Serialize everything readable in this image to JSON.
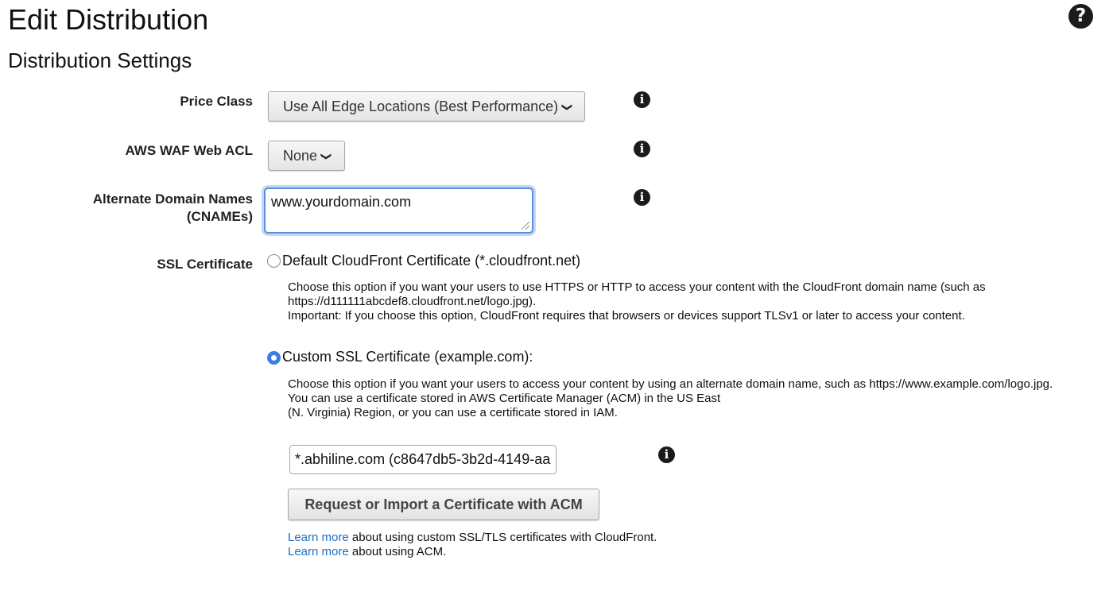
{
  "header": {
    "title": "Edit Distribution",
    "help_icon": "question-circle-icon",
    "help_glyph": "?"
  },
  "section": {
    "title": "Distribution Settings"
  },
  "fields": {
    "price_class": {
      "label": "Price Class",
      "value": "Use All Edge Locations (Best Performance)"
    },
    "waf": {
      "label": "AWS WAF Web ACL",
      "value": "None"
    },
    "cnames": {
      "label_line1": "Alternate Domain Names",
      "label_line2": "(CNAMEs)",
      "value": "www.yourdomain.com"
    },
    "ssl": {
      "label": "SSL Certificate"
    }
  },
  "info_icon": {
    "icon": "info-circle-icon",
    "glyph": "i"
  },
  "chevron_glyph": "❯",
  "ssl_options": {
    "default": {
      "label": "Default CloudFront Certificate (*.cloudfront.net)",
      "selected": false,
      "desc_line1": "Choose this option if you want your users to use HTTPS or HTTP to access your content with the CloudFront domain name (such as",
      "desc_line2": "https://d111111abcdef8.cloudfront.net/logo.jpg).",
      "desc_line3": "Important: If you choose this option, CloudFront requires that browsers or devices support TLSv1 or later to access your content."
    },
    "custom": {
      "label": "Custom SSL Certificate (example.com):",
      "selected": true,
      "desc_line1": "Choose this option if you want your users to access your content by using an alternate domain name, such as https://www.example.com/logo.jpg.",
      "desc_line2": "You can use a certificate stored in AWS Certificate Manager (ACM) in the US East",
      "desc_line3": "(N. Virginia) Region, or you can use a certificate stored in IAM.",
      "certificate_value": "*.abhiline.com (c8647db5-3b2d-4149-aa",
      "acm_button": "Request or Import a Certificate with ACM"
    }
  },
  "learn_more": [
    {
      "link": "Learn more",
      "text": " about using custom SSL/TLS certificates with CloudFront."
    },
    {
      "link": "Learn more",
      "text": " about using ACM."
    }
  ],
  "colors": {
    "link": "#1b6fc4",
    "focus": "#5d8fd8",
    "radio_selected": "#3b7de0"
  }
}
